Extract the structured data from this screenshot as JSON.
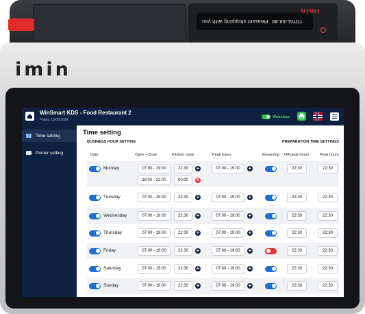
{
  "device": {
    "brand": "imin",
    "top_brand": "imin",
    "mini_display": {
      "left": "Pleasant shopping with you",
      "right": "TOTAL:68.86"
    }
  },
  "app": {
    "title": "WinSmart KDS  - Food Restaurant 2",
    "date": "Friday, 15/06/2024",
    "webshop_toggle": "on",
    "webshop_label": "Webshop",
    "accent_color": "#0f2140",
    "green_color": "#2fbf4f"
  },
  "sidebar": {
    "items": [
      {
        "label": "Time setting",
        "icon": "calendar-icon",
        "active": true
      },
      {
        "label": "Printer setting",
        "icon": "printer-icon",
        "active": false
      }
    ]
  },
  "main": {
    "title": "Time setting",
    "section_left": "BUSINESS HOUR SETTING",
    "section_right": "PREPARATION TIME SETTINGS",
    "columns": {
      "date": "Date",
      "open_close": "Open - Close",
      "kitchen_close": "Kitchen close",
      "peak_hours": "Peak hours",
      "reserving": "Reserving",
      "offpeak_hours": "Off-peak hours",
      "prep_peak_hours": "Peak hours"
    },
    "days": [
      {
        "day": "Monday",
        "enabled": true,
        "open_close": "07:00 - 19:00",
        "kitchen_close": "22:30",
        "peak": "07:00 - 19:00",
        "reserving": true,
        "offpeak_time": "22:30",
        "peak_time": "22:30",
        "extra": {
          "open_close": "18:00 - 22:00",
          "kitchen_close": "00:00"
        }
      },
      {
        "day": "Tuesday",
        "enabled": true,
        "open_close": "07:00 - 19:00",
        "kitchen_close": "22:30",
        "peak": "07:00 - 19:00",
        "reserving": true,
        "offpeak_time": "22:30",
        "peak_time": "22:30"
      },
      {
        "day": "Wednesday",
        "enabled": true,
        "open_close": "07:00 - 19:00",
        "kitchen_close": "22:30",
        "peak": "07:00 - 19:00",
        "reserving": true,
        "offpeak_time": "22:30",
        "peak_time": "22:30"
      },
      {
        "day": "Thursday",
        "enabled": true,
        "open_close": "07:00 - 19:00",
        "kitchen_close": "22:30",
        "peak": "07:00 - 19:00",
        "reserving": true,
        "offpeak_time": "22:30",
        "peak_time": "22:30"
      },
      {
        "day": "Friday",
        "enabled": true,
        "open_close": "07:00 - 19:00",
        "kitchen_close": "22:30",
        "peak": "07:00 - 19:00",
        "reserving": false,
        "offpeak_time": "22:30",
        "peak_time": "22:30"
      },
      {
        "day": "Saturday",
        "enabled": true,
        "open_close": "07:00 - 19:00",
        "kitchen_close": "22:30",
        "peak": "07:00 - 19:00",
        "reserving": true,
        "offpeak_time": "22:30",
        "peak_time": "22:30"
      },
      {
        "day": "Sunday",
        "enabled": true,
        "open_close": "07:00 - 19:00",
        "kitchen_close": "22:30",
        "peak": "07:00 - 19:00",
        "reserving": true,
        "offpeak_time": "22:30",
        "peak_time": "22:30"
      }
    ]
  }
}
